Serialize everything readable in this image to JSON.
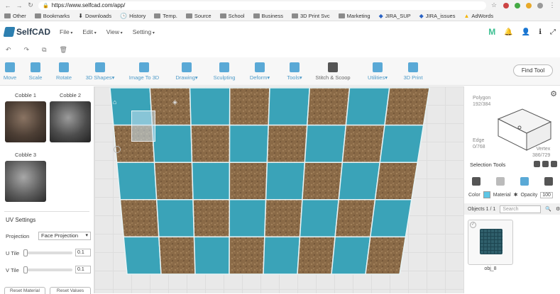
{
  "browser": {
    "url": "https://www.selfcad.com/app/",
    "bookmarks": [
      "Other",
      "Bookmarks",
      "Downloads",
      "History",
      "Temp.",
      "Source",
      "School",
      "Business",
      "3D Print Svc",
      "Marketing",
      "JIRA_SUP",
      "JIRA_issues",
      "AdWords"
    ]
  },
  "app": {
    "logo": "SelfCAD",
    "menus": [
      "File",
      "Edit",
      "View",
      "Setting"
    ]
  },
  "toolbar": {
    "tools": [
      {
        "label": "Move",
        "icon": "move-icon"
      },
      {
        "label": "Scale",
        "icon": "scale-icon"
      },
      {
        "label": "Rotate",
        "icon": "rotate-icon"
      },
      {
        "label": "3D Shapes▾",
        "icon": "cube-icon"
      },
      {
        "label": "Image To 3D",
        "icon": "image-icon"
      },
      {
        "label": "Drawing▾",
        "icon": "pencil-icon"
      },
      {
        "label": "Sculpting",
        "icon": "sculpt-icon"
      },
      {
        "label": "Deform▾",
        "icon": "deform-icon"
      },
      {
        "label": "Tools▾",
        "icon": "tools-icon"
      },
      {
        "label": "Stitch & Scoop",
        "icon": "stitch-icon"
      },
      {
        "label": "Utilities▾",
        "icon": "utilities-icon"
      },
      {
        "label": "3D Print",
        "icon": "print-icon"
      }
    ],
    "find_tool": "Find Tool"
  },
  "materials": [
    {
      "name": "Cobble 1"
    },
    {
      "name": "Cobble 2"
    },
    {
      "name": "Cobble 3"
    }
  ],
  "uv": {
    "title": "UV Settings",
    "projection_label": "Projection",
    "projection_value": "Face Projection",
    "u_label": "U Tile",
    "u_value": "0.1",
    "v_label": "V Tile",
    "v_value": "0.1",
    "reset_material": "Reset Material",
    "reset_values": "Reset Values"
  },
  "stats": {
    "polygon_label": "Polygon",
    "polygon_value": "192/384",
    "edge_label": "Edge",
    "edge_value": "0/768",
    "vertex_label": "Vertex",
    "vertex_value": "386/729"
  },
  "selection": {
    "title": "Selection Tools",
    "color_label": "Color",
    "material_label": "Material",
    "opacity_label": "Opacity",
    "opacity_value": "100"
  },
  "objects": {
    "header": "Objects 1 / 1",
    "search_placeholder": "Search",
    "items": [
      {
        "name": "obj_8"
      }
    ]
  },
  "colors": {
    "tile_teal": "#3aa3b8",
    "tile_wood": "#8a6a47",
    "accent": "#4f9bc8"
  }
}
